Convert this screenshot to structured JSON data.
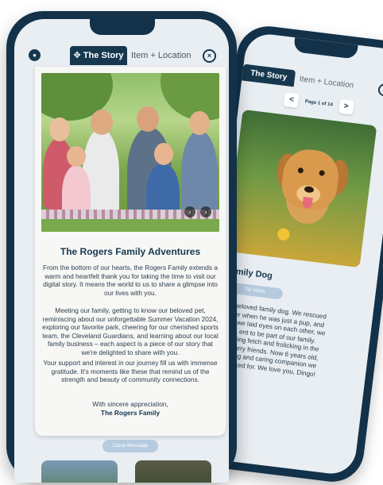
{
  "back_phone": {
    "tabs": {
      "active": "The Story",
      "inactive": "Item + Location"
    },
    "pager": {
      "label": "Page 1 of 14",
      "prev": "<",
      "next": ">"
    },
    "title": "mily Dog",
    "button": "Tip Video",
    "text_lines": [
      "beloved family dog. We rescued",
      "er when he was just a pup, and",
      "e we laid eyes on each other, we",
      "ent to be part of our family.",
      "ying fetch and frolicking in the",
      "furry friends. Now 6 years old,",
      "ing and caring companion we",
      "sked for. We love you, Dingo!"
    ]
  },
  "front_phone": {
    "tabs": {
      "active": "The Story",
      "inactive": "Item + Location",
      "active_icon": "✥"
    },
    "photo_nav": {
      "prev": "‹",
      "next": "›"
    },
    "story": {
      "title": "The Rogers Family Adventures",
      "para1": "From the bottom of our hearts, the Rogers Family extends a warm and heartfelt thank you for taking the time to visit our digital story. It means the world to us to share a glimpse into our lives with you.",
      "para2": "Meeting our family, getting to know our beloved pet, reminiscing about our unforgettable Summer Vacation 2024, exploring our favorite park, cheering for our cherished sports team, the Cleveland Guardians, and learning about our local family business – each aspect is a piece of our story that we're delighted to share with you.",
      "para3": "Your support and interest in our journey fill us with immense gratitude. It's moments like these that remind us of the strength and beauty of community connections.",
      "sign_off": "With sincere appreciation,",
      "signature": "The Rogers Family"
    },
    "close_button": "Close Message"
  }
}
